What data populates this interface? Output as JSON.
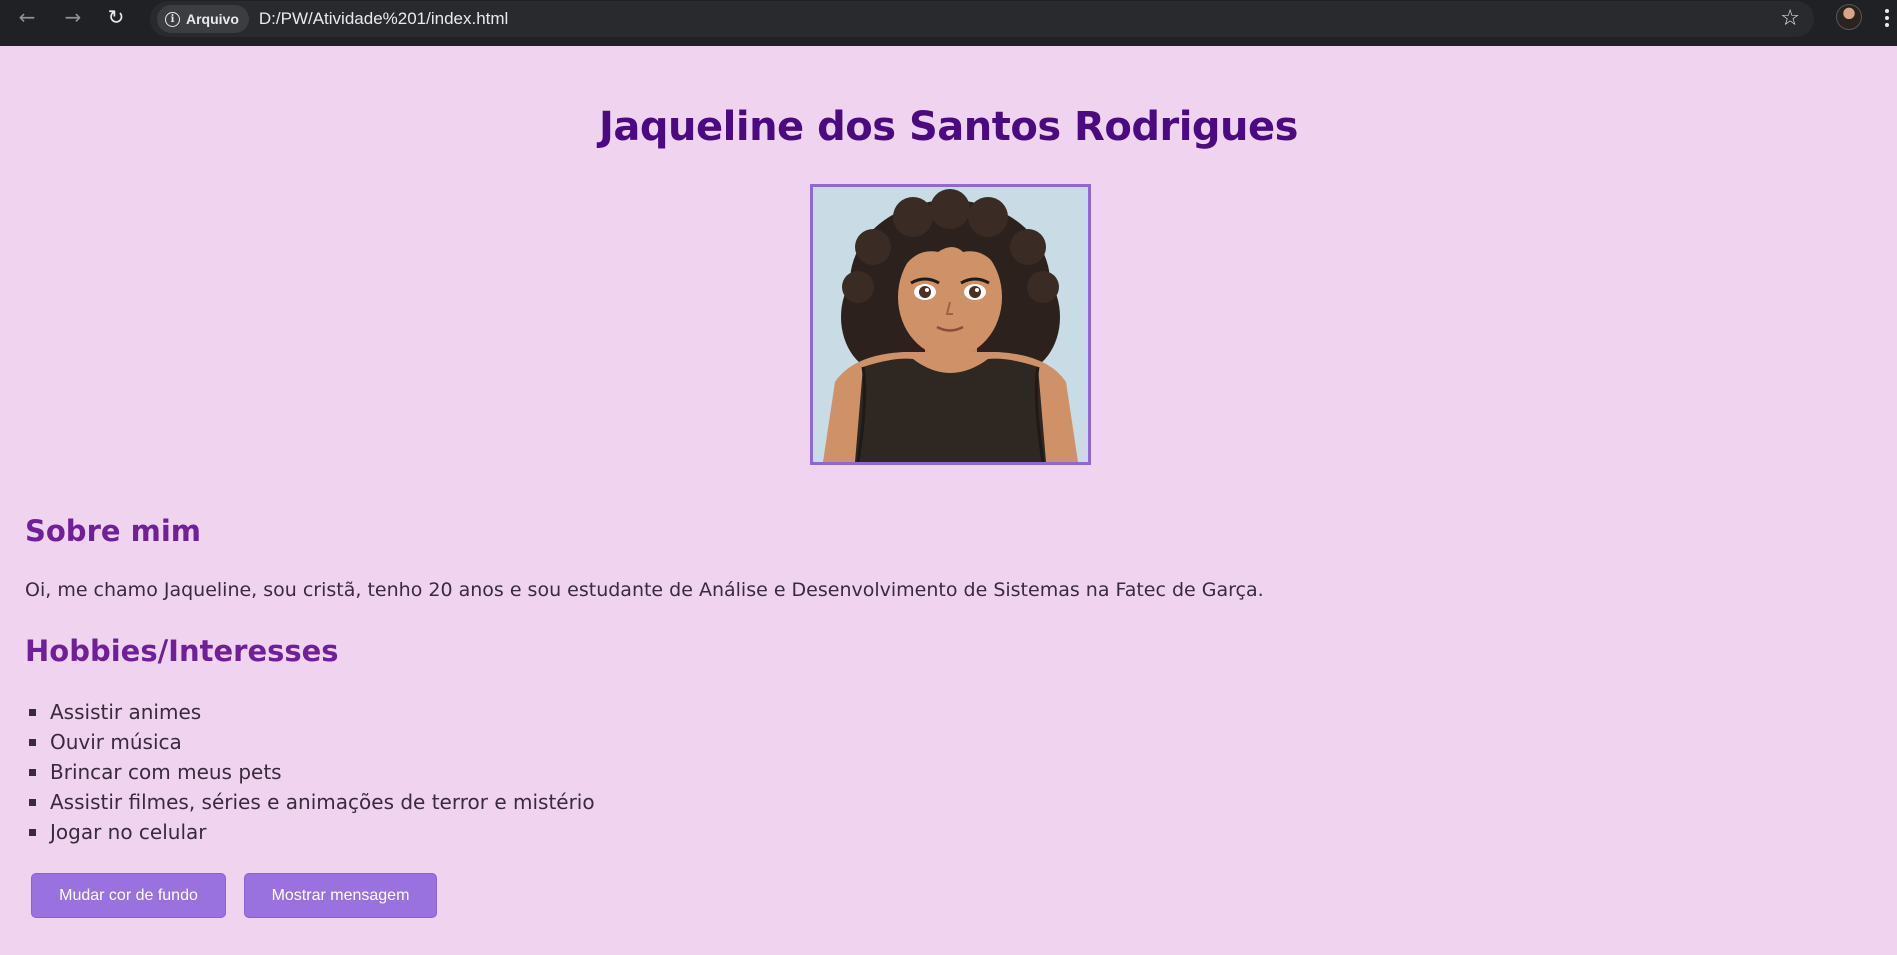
{
  "browser": {
    "site_chip_label": "Arquivo",
    "url": "D:/PW/Atividade%201/index.html",
    "icons": [
      "back-arrow-icon",
      "forward-arrow-icon",
      "reload-icon",
      "info-icon",
      "star-icon",
      "avatar",
      "menu-dots-icon"
    ]
  },
  "profile": {
    "name": "Jaqueline dos Santos Rodrigues"
  },
  "about": {
    "heading": "Sobre mim",
    "text": "Oi, me chamo Jaqueline, sou cristã, tenho 20 anos e sou estudante de Análise e Desenvolvimento de Sistemas na Fatec de Garça."
  },
  "hobbies": {
    "heading": "Hobbies/Interesses",
    "items": [
      "Assistir animes",
      "Ouvir música",
      "Brincar com meus pets",
      "Assistir filmes, séries e animações de terror e mistério",
      "Jogar no celular"
    ]
  },
  "buttons": {
    "change_bg_label": "Mudar cor de fundo",
    "show_message_label": "Mostrar mensagem"
  },
  "colors": {
    "page_background": "#f0d4ef",
    "title": "#4b0a80",
    "heading": "#6f1f97",
    "button": "#9a72e0",
    "portrait_border": "#9166db"
  }
}
